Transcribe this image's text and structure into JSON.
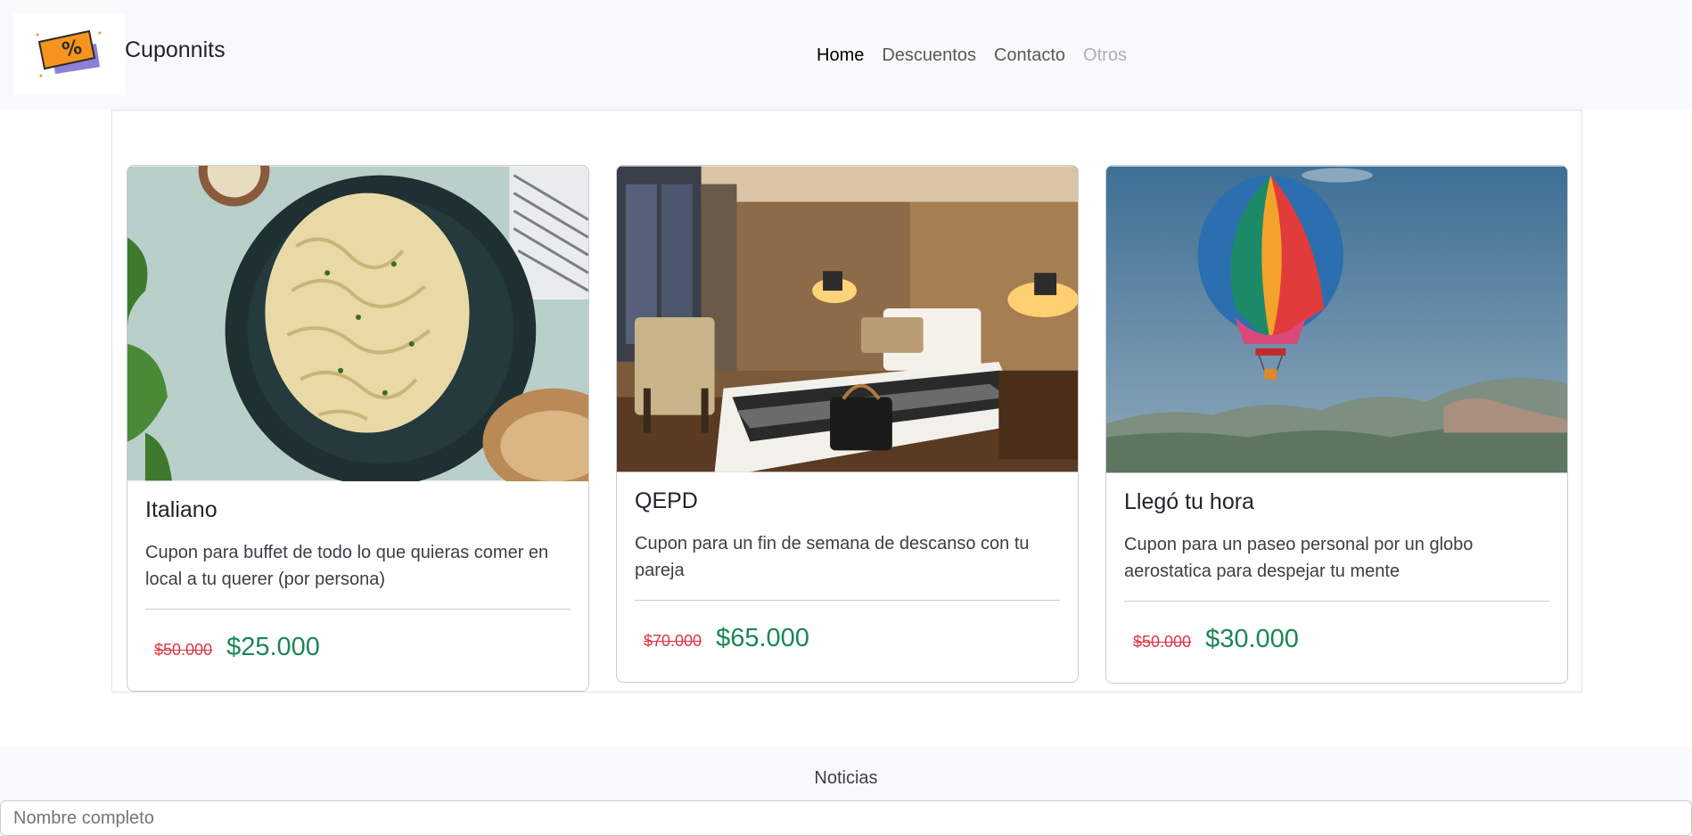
{
  "brand": {
    "name": "Cuponnits",
    "logo_icon": "percent-ticket-icon"
  },
  "nav": {
    "items": [
      {
        "label": "Home",
        "state": "active"
      },
      {
        "label": "Descuentos",
        "state": "normal"
      },
      {
        "label": "Contacto",
        "state": "normal"
      },
      {
        "label": "Otros",
        "state": "disabled"
      }
    ]
  },
  "cards": [
    {
      "image": "pasta-image",
      "title": "Italiano",
      "text": "Cupon para buffet de todo lo que quieras comer en local a tu querer (por persona)",
      "old_price": "$50.000",
      "new_price": "$25.000"
    },
    {
      "image": "hotel-room-image",
      "title": "QEPD",
      "text": "Cupon para un fin de semana de descanso con tu pareja",
      "old_price": "$70.000",
      "new_price": "$65.000"
    },
    {
      "image": "hot-air-balloon-image",
      "title": "Llegó tu hora",
      "text": "Cupon para un paseo personal por un globo aerostatica para despejar tu mente",
      "old_price": "$50.000",
      "new_price": "$30.000"
    }
  ],
  "footer": {
    "title": "Noticias",
    "input_placeholder": "Nombre completo"
  },
  "colors": {
    "old_price": "#dc3545",
    "new_price": "#198754",
    "navbar_bg": "#f8f9fa"
  }
}
